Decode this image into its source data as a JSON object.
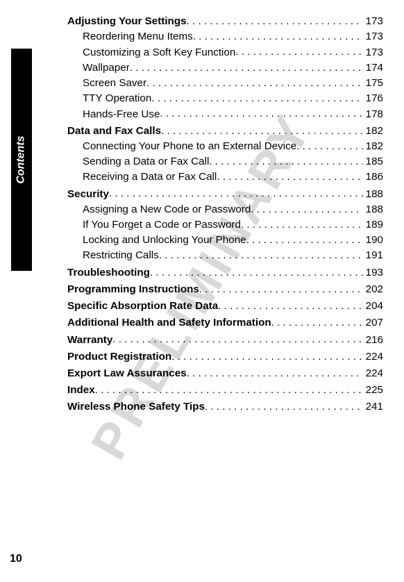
{
  "watermark": "PRELIMINARY",
  "side_label": "Contents",
  "page_number": "10",
  "toc": [
    {
      "label": "Adjusting Your Settings",
      "page": "173",
      "bold": true,
      "indent": 0
    },
    {
      "label": "Reordering Menu Items",
      "page": "173",
      "bold": false,
      "indent": 1
    },
    {
      "label": "Customizing a Soft Key Function",
      "page": "173",
      "bold": false,
      "indent": 1
    },
    {
      "label": "Wallpaper",
      "page": "174",
      "bold": false,
      "indent": 1
    },
    {
      "label": "Screen Saver",
      "page": "175",
      "bold": false,
      "indent": 1
    },
    {
      "label": "TTY Operation",
      "page": "176",
      "bold": false,
      "indent": 1
    },
    {
      "label": "Hands-Free Use ",
      "page": "178",
      "bold": false,
      "indent": 1
    },
    {
      "label": "Data and Fax Calls",
      "page": "182",
      "bold": true,
      "indent": 0
    },
    {
      "label": "Connecting Your Phone to an External Device ",
      "page": "182",
      "bold": false,
      "indent": 1
    },
    {
      "label": "Sending a Data or Fax Call ",
      "page": "185",
      "bold": false,
      "indent": 1
    },
    {
      "label": "Receiving a Data or Fax Call",
      "page": "186",
      "bold": false,
      "indent": 1
    },
    {
      "label": "Security",
      "page": "188",
      "bold": true,
      "indent": 0
    },
    {
      "label": "Assigning a New Code or Password ",
      "page": "188",
      "bold": false,
      "indent": 1
    },
    {
      "label": "If You Forget a Code or Password ",
      "page": "189",
      "bold": false,
      "indent": 1
    },
    {
      "label": "Locking and Unlocking Your Phone ",
      "page": "190",
      "bold": false,
      "indent": 1
    },
    {
      "label": "Restricting Calls",
      "page": "191",
      "bold": false,
      "indent": 1
    },
    {
      "label": "Troubleshooting",
      "page": "193",
      "bold": true,
      "indent": 0
    },
    {
      "label": "Programming Instructions ",
      "page": "202",
      "bold": true,
      "indent": 0
    },
    {
      "label": "Specific Absorption Rate Data",
      "page": "204",
      "bold": true,
      "indent": 0
    },
    {
      "label": "Additional Health and Safety Information",
      "page": "207",
      "bold": true,
      "indent": 0
    },
    {
      "label": "Warranty",
      "page": "216",
      "bold": true,
      "indent": 0
    },
    {
      "label": "Product Registration",
      "page": "224",
      "bold": true,
      "indent": 0
    },
    {
      "label": "Export Law Assurances ",
      "page": "224",
      "bold": true,
      "indent": 0
    },
    {
      "label": "Index",
      "page": "225",
      "bold": true,
      "indent": 0
    },
    {
      "label": "Wireless Phone Safety Tips",
      "page": "241",
      "bold": true,
      "indent": 0
    }
  ]
}
